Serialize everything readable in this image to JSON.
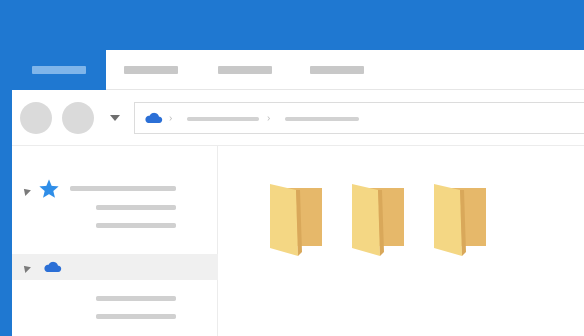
{
  "colors": {
    "accent": "#1f78d1",
    "folder_front": "#f4d784",
    "folder_back": "#e6b86a",
    "cloud": "#2b6fd6",
    "star": "#2f8ee8"
  },
  "ribbon": {
    "tabs": [
      {
        "label": "",
        "active": true
      },
      {
        "label": "",
        "active": false
      },
      {
        "label": "",
        "active": false
      },
      {
        "label": "",
        "active": false
      }
    ]
  },
  "navigation": {
    "back_button_icon": "back-circle-icon",
    "forward_button_icon": "forward-circle-icon",
    "recent_dropdown_icon": "chevron-down-icon",
    "address_icon": "cloud-icon",
    "breadcrumbs": [
      "",
      ""
    ]
  },
  "nav_pane": {
    "items": [
      {
        "icon": "star-icon",
        "label": "",
        "children": [
          "",
          ""
        ]
      },
      {
        "icon": "cloud-icon",
        "label": "",
        "children": [
          "",
          ""
        ],
        "selected": true
      }
    ]
  },
  "content": {
    "folders": [
      {
        "icon": "folder-icon",
        "label": ""
      },
      {
        "icon": "folder-icon",
        "label": ""
      },
      {
        "icon": "folder-icon",
        "label": ""
      }
    ]
  }
}
